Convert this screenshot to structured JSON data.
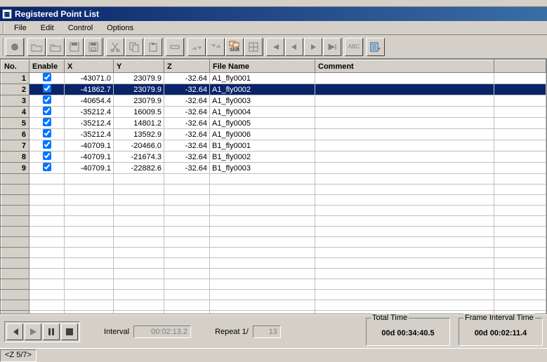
{
  "window": {
    "title": "Registered Point List"
  },
  "menu": {
    "file": "File",
    "edit": "Edit",
    "control": "Control",
    "options": "Options"
  },
  "toolbar": {
    "shift_label": "Shift",
    "abc_label": "ABC"
  },
  "columns": {
    "no": "No.",
    "enable": "Enable",
    "x": "X",
    "y": "Y",
    "z": "Z",
    "file": "File Name",
    "comment": "Comment"
  },
  "rows": [
    {
      "no": 1,
      "enable": true,
      "x": "-43071.0",
      "y": "23079.9",
      "z": "-32.64",
      "file": "A1_fly0001",
      "comment": "",
      "selected": false
    },
    {
      "no": 2,
      "enable": true,
      "x": "-41862.7",
      "y": "23079.9",
      "z": "-32.64",
      "file": "A1_fly0002",
      "comment": "",
      "selected": true
    },
    {
      "no": 3,
      "enable": true,
      "x": "-40654.4",
      "y": "23079.9",
      "z": "-32.64",
      "file": "A1_fly0003",
      "comment": "",
      "selected": false
    },
    {
      "no": 4,
      "enable": true,
      "x": "-35212.4",
      "y": "16009.5",
      "z": "-32.64",
      "file": "A1_fly0004",
      "comment": "",
      "selected": false
    },
    {
      "no": 5,
      "enable": true,
      "x": "-35212.4",
      "y": "14801.2",
      "z": "-32.64",
      "file": "A1_fly0005",
      "comment": "",
      "selected": false
    },
    {
      "no": 6,
      "enable": true,
      "x": "-35212.4",
      "y": "13592.9",
      "z": "-32.64",
      "file": "A1_fly0006",
      "comment": "",
      "selected": false
    },
    {
      "no": 7,
      "enable": true,
      "x": "-40709.1",
      "y": "-20466.0",
      "z": "-32.64",
      "file": "B1_fly0001",
      "comment": "",
      "selected": false
    },
    {
      "no": 8,
      "enable": true,
      "x": "-40709.1",
      "y": "-21674.3",
      "z": "-32.64",
      "file": "B1_fly0002",
      "comment": "",
      "selected": false
    },
    {
      "no": 9,
      "enable": true,
      "x": "-40709.1",
      "y": "-22882.6",
      "z": "-32.64",
      "file": "B1_fly0003",
      "comment": "",
      "selected": false
    }
  ],
  "playback": {
    "interval_label": "Interval",
    "interval_value": "00:02:13.2",
    "repeat_label": "Repeat",
    "repeat_current": "1/",
    "repeat_total": "13"
  },
  "totals": {
    "total_time_label": "Total Time",
    "total_time_value": "00d 00:34:40.5",
    "frame_interval_label": "Frame Interval Time",
    "frame_interval_value": "00d 00:02:11.4"
  },
  "status": {
    "z": "<Z 5/7>"
  }
}
